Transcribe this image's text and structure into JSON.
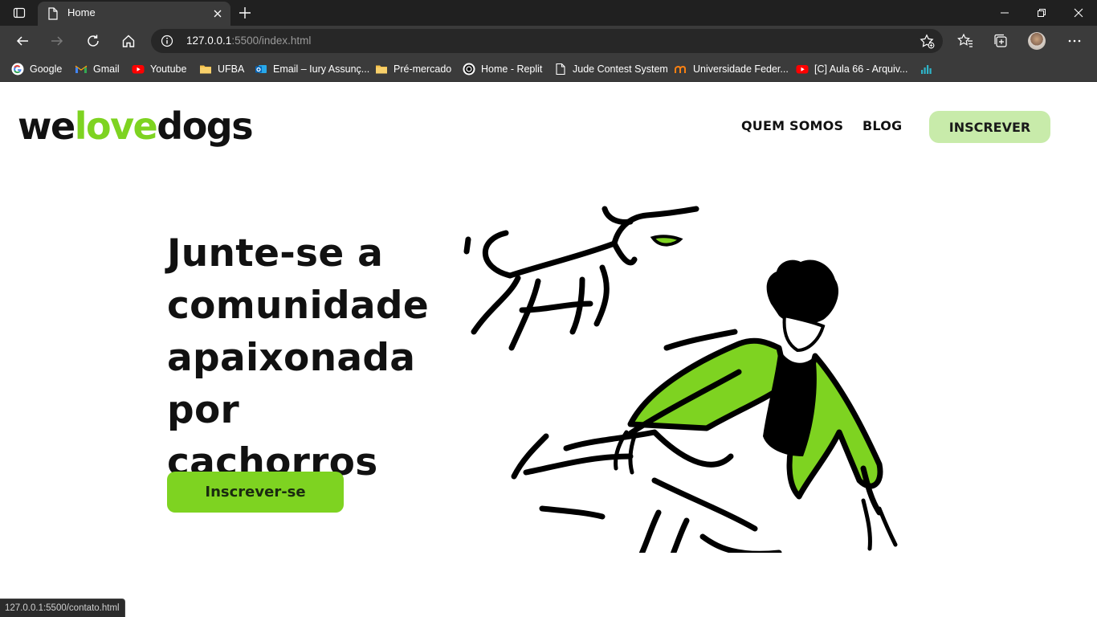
{
  "browser": {
    "tab_title": "Home",
    "url_host": "127.0.0.1",
    "url_rest": ":5500/index.html",
    "bookmarks": [
      {
        "label": "Google",
        "icon": "google-icon"
      },
      {
        "label": "Gmail",
        "icon": "gmail-icon"
      },
      {
        "label": "Youtube",
        "icon": "youtube-icon"
      },
      {
        "label": "UFBA",
        "icon": "folder-icon"
      },
      {
        "label": "Email – Iury Assunç...",
        "icon": "outlook-icon"
      },
      {
        "label": "Pré-mercado",
        "icon": "folder-icon"
      },
      {
        "label": "Home - Replit",
        "icon": "replit-icon"
      },
      {
        "label": "Jude Contest System",
        "icon": "page-icon"
      },
      {
        "label": "Universidade Feder...",
        "icon": "moodle-icon"
      },
      {
        "label": "[C] Aula 66 - Arquiv...",
        "icon": "youtube-icon"
      },
      {
        "label": "",
        "icon": "chart-icon"
      }
    ],
    "status_url": "127.0.0.1:5500/contato.html"
  },
  "site": {
    "logo_part1": "we",
    "logo_part2": "love",
    "logo_part3": "dogs",
    "nav_about": "QUEM SOMOS",
    "nav_blog": "BLOG",
    "nav_signup": "INSCREVER",
    "hero_title": "Junte-se a comunidade apaixonada por cachorros",
    "hero_button": "Inscrever-se"
  },
  "colors": {
    "brand_green": "#7ed321",
    "light_green": "#c8ebaa",
    "text": "#111111"
  }
}
